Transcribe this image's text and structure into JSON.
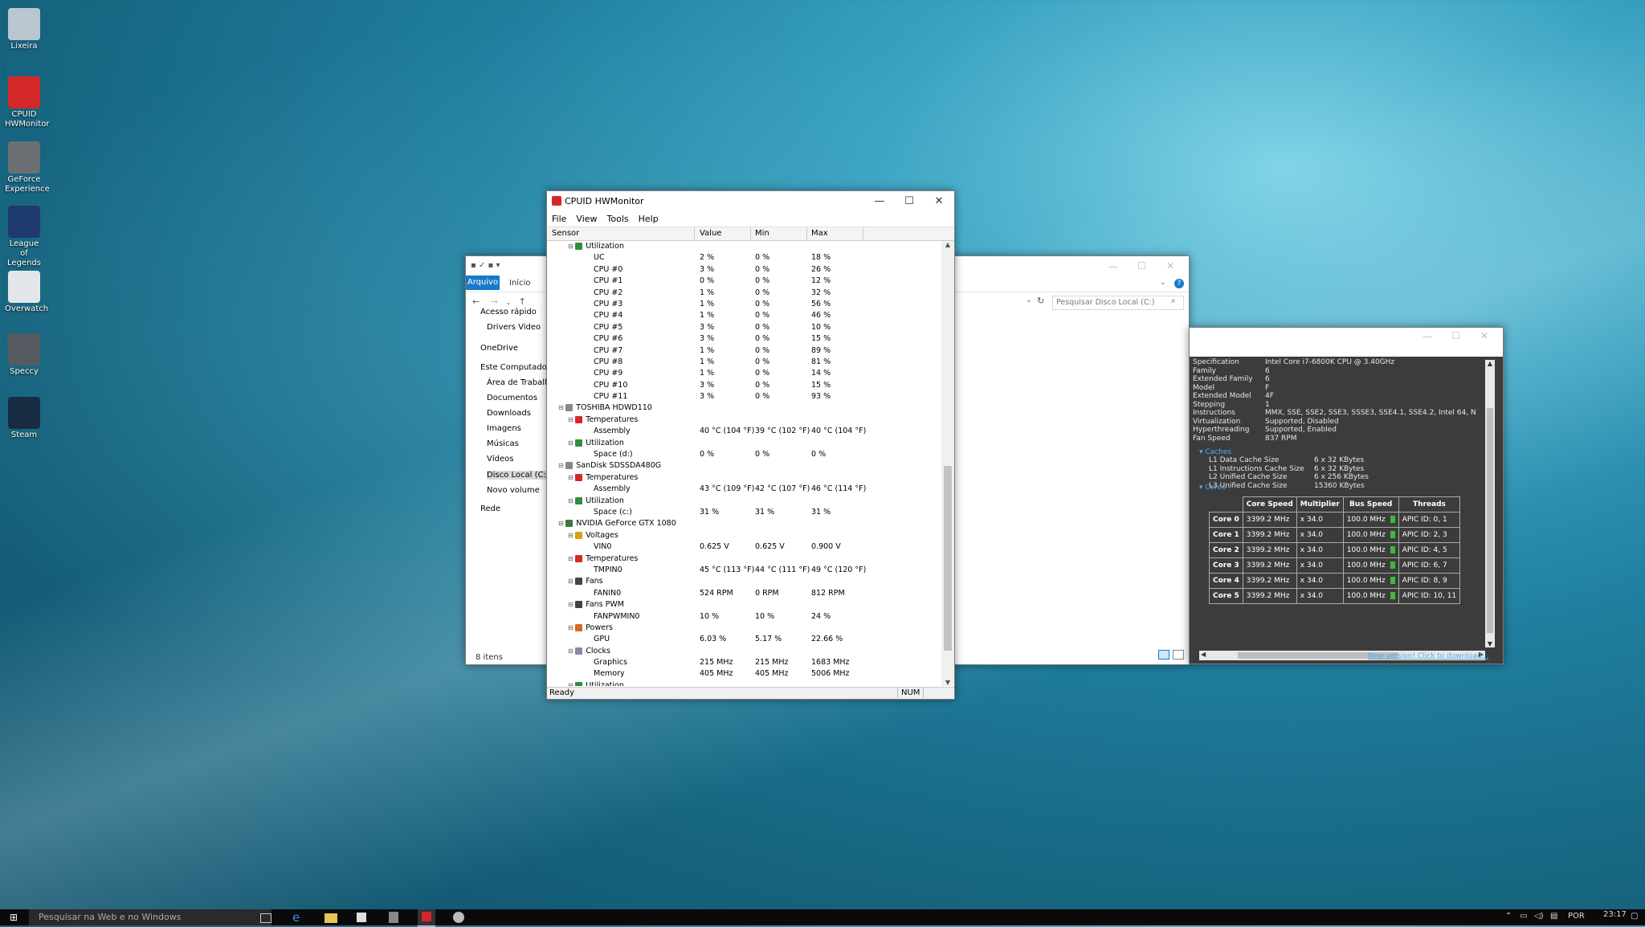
{
  "desktop": {
    "icons": [
      {
        "label": "Lixeira"
      },
      {
        "label": "CPUID HWMonitor"
      },
      {
        "label": "GeForce Experience"
      },
      {
        "label": "League of Legends"
      },
      {
        "label": "Overwatch"
      },
      {
        "label": "Speccy"
      },
      {
        "label": "Steam"
      }
    ]
  },
  "hwmonitor": {
    "title": "CPUID HWMonitor",
    "menu": [
      "File",
      "View",
      "Tools",
      "Help"
    ],
    "columns": {
      "sensor": "Sensor",
      "value": "Value",
      "min": "Min",
      "max": "Max"
    },
    "rows": [
      {
        "level": 2,
        "label": "Utilization",
        "value": "",
        "min": "",
        "max": "",
        "icon": "util"
      },
      {
        "level": 3,
        "label": "UC",
        "value": "2 %",
        "min": "0 %",
        "max": "18 %"
      },
      {
        "level": 3,
        "label": "CPU #0",
        "value": "3 %",
        "min": "0 %",
        "max": "26 %"
      },
      {
        "level": 3,
        "label": "CPU #1",
        "value": "0 %",
        "min": "0 %",
        "max": "12 %"
      },
      {
        "level": 3,
        "label": "CPU #2",
        "value": "1 %",
        "min": "0 %",
        "max": "32 %"
      },
      {
        "level": 3,
        "label": "CPU #3",
        "value": "1 %",
        "min": "0 %",
        "max": "56 %"
      },
      {
        "level": 3,
        "label": "CPU #4",
        "value": "1 %",
        "min": "0 %",
        "max": "46 %"
      },
      {
        "level": 3,
        "label": "CPU #5",
        "value": "3 %",
        "min": "0 %",
        "max": "10 %"
      },
      {
        "level": 3,
        "label": "CPU #6",
        "value": "3 %",
        "min": "0 %",
        "max": "15 %"
      },
      {
        "level": 3,
        "label": "CPU #7",
        "value": "1 %",
        "min": "0 %",
        "max": "89 %"
      },
      {
        "level": 3,
        "label": "CPU #8",
        "value": "1 %",
        "min": "0 %",
        "max": "81 %"
      },
      {
        "level": 3,
        "label": "CPU #9",
        "value": "1 %",
        "min": "0 %",
        "max": "14 %"
      },
      {
        "level": 3,
        "label": "CPU #10",
        "value": "3 %",
        "min": "0 %",
        "max": "15 %"
      },
      {
        "level": 3,
        "label": "CPU #11",
        "value": "3 %",
        "min": "0 %",
        "max": "93 %"
      },
      {
        "level": 1,
        "label": "TOSHIBA HDWD110",
        "value": "",
        "min": "",
        "max": "",
        "icon": "disk"
      },
      {
        "level": 2,
        "label": "Temperatures",
        "value": "",
        "min": "",
        "max": "",
        "icon": "temp"
      },
      {
        "level": 3,
        "label": "Assembly",
        "value": "40 °C (104 °F)",
        "min": "39 °C (102 °F)",
        "max": "40 °C (104 °F)"
      },
      {
        "level": 2,
        "label": "Utilization",
        "value": "",
        "min": "",
        "max": "",
        "icon": "util"
      },
      {
        "level": 3,
        "label": "Space (d:)",
        "value": "0 %",
        "min": "0 %",
        "max": "0 %"
      },
      {
        "level": 1,
        "label": "SanDisk SDSSDA480G",
        "value": "",
        "min": "",
        "max": "",
        "icon": "disk"
      },
      {
        "level": 2,
        "label": "Temperatures",
        "value": "",
        "min": "",
        "max": "",
        "icon": "temp"
      },
      {
        "level": 3,
        "label": "Assembly",
        "value": "43 °C (109 °F)",
        "min": "42 °C (107 °F)",
        "max": "46 °C (114 °F)"
      },
      {
        "level": 2,
        "label": "Utilization",
        "value": "",
        "min": "",
        "max": "",
        "icon": "util"
      },
      {
        "level": 3,
        "label": "Space (c:)",
        "value": "31 %",
        "min": "31 %",
        "max": "31 %"
      },
      {
        "level": 1,
        "label": "NVIDIA GeForce GTX 1080",
        "value": "",
        "min": "",
        "max": "",
        "icon": "gpu"
      },
      {
        "level": 2,
        "label": "Voltages",
        "value": "",
        "min": "",
        "max": "",
        "icon": "volt"
      },
      {
        "level": 3,
        "label": "VIN0",
        "value": "0.625 V",
        "min": "0.625 V",
        "max": "0.900 V"
      },
      {
        "level": 2,
        "label": "Temperatures",
        "value": "",
        "min": "",
        "max": "",
        "icon": "temp"
      },
      {
        "level": 3,
        "label": "TMPIN0",
        "value": "45 °C (113 °F)",
        "min": "44 °C (111 °F)",
        "max": "49 °C (120 °F)"
      },
      {
        "level": 2,
        "label": "Fans",
        "value": "",
        "min": "",
        "max": "",
        "icon": "fan"
      },
      {
        "level": 3,
        "label": "FANIN0",
        "value": "524 RPM",
        "min": "0 RPM",
        "max": "812 RPM"
      },
      {
        "level": 2,
        "label": "Fans PWM",
        "value": "",
        "min": "",
        "max": "",
        "icon": "fan"
      },
      {
        "level": 3,
        "label": "FANPWMIN0",
        "value": "10 %",
        "min": "10 %",
        "max": "24 %"
      },
      {
        "level": 2,
        "label": "Powers",
        "value": "",
        "min": "",
        "max": "",
        "icon": "power"
      },
      {
        "level": 3,
        "label": "GPU",
        "value": "6.03 %",
        "min": "5.17 %",
        "max": "22.66 %"
      },
      {
        "level": 2,
        "label": "Clocks",
        "value": "",
        "min": "",
        "max": "",
        "icon": "clock"
      },
      {
        "level": 3,
        "label": "Graphics",
        "value": "215 MHz",
        "min": "215 MHz",
        "max": "1683 MHz"
      },
      {
        "level": 3,
        "label": "Memory",
        "value": "405 MHz",
        "min": "405 MHz",
        "max": "5006 MHz"
      },
      {
        "level": 2,
        "label": "Utilization",
        "value": "",
        "min": "",
        "max": "",
        "icon": "util"
      }
    ],
    "status": "Ready",
    "status_num": "NUM"
  },
  "explorer": {
    "tab_active": "Arquivo",
    "tab_inicio": "Início",
    "search_placeholder": "Pesquisar Disco Local (C:)",
    "nav": [
      {
        "label": "Acesso rápido",
        "top": 0
      },
      {
        "label": "Drivers Video"
      },
      {
        "label": "OneDrive"
      },
      {
        "label": "Este Computador"
      },
      {
        "label": "Área de Trabalho"
      },
      {
        "label": "Documentos"
      },
      {
        "label": "Downloads"
      },
      {
        "label": "Imagens"
      },
      {
        "label": "Músicas"
      },
      {
        "label": "Vídeos"
      },
      {
        "label": "Disco Local (C:)"
      },
      {
        "label": "Novo volume"
      },
      {
        "label": "Rede"
      }
    ],
    "item_count": "8 itens"
  },
  "speccy": {
    "lines": [
      {
        "k": "Specification",
        "v": "Intel Core i7-6800K CPU @ 3.40GHz"
      },
      {
        "k": "Family",
        "v": "6"
      },
      {
        "k": "Extended Family",
        "v": "6"
      },
      {
        "k": "Model",
        "v": "F"
      },
      {
        "k": "Extended Model",
        "v": "4F"
      },
      {
        "k": "Stepping",
        "v": "1"
      },
      {
        "k": "Instructions",
        "v": "MMX, SSE, SSE2, SSE3, SSSE3, SSE4.1, SSE4.2, Intel 64, N"
      },
      {
        "k": "Virtualization",
        "v": "Supported, Disabled"
      },
      {
        "k": "Hyperthreading",
        "v": "Supported, Enabled"
      },
      {
        "k": "Fan Speed",
        "v": "837 RPM"
      }
    ],
    "caches_label": "Caches",
    "caches": [
      {
        "k": "L1 Data Cache Size",
        "v": "6 x 32 KBytes"
      },
      {
        "k": "L1 Instructions Cache Size",
        "v": "6 x 32 KBytes"
      },
      {
        "k": "L2 Unified Cache Size",
        "v": "6 x 256 KBytes"
      },
      {
        "k": "L3 Unified Cache Size",
        "v": "15360 KBytes"
      }
    ],
    "cores_label": "Cores",
    "table_headers": [
      "",
      "Core Speed",
      "Multiplier",
      "Bus Speed",
      "Threads"
    ],
    "cores": [
      {
        "name": "Core 0",
        "speed": "3399.2 MHz",
        "mult": "x 34.0",
        "bus": "100.0 MHz",
        "threads": "APIC ID: 0, 1"
      },
      {
        "name": "Core 1",
        "speed": "3399.2 MHz",
        "mult": "x 34.0",
        "bus": "100.0 MHz",
        "threads": "APIC ID: 2, 3"
      },
      {
        "name": "Core 2",
        "speed": "3399.2 MHz",
        "mult": "x 34.0",
        "bus": "100.0 MHz",
        "threads": "APIC ID: 4, 5"
      },
      {
        "name": "Core 3",
        "speed": "3399.2 MHz",
        "mult": "x 34.0",
        "bus": "100.0 MHz",
        "threads": "APIC ID: 6, 7"
      },
      {
        "name": "Core 4",
        "speed": "3399.2 MHz",
        "mult": "x 34.0",
        "bus": "100.0 MHz",
        "threads": "APIC ID: 8, 9"
      },
      {
        "name": "Core 5",
        "speed": "3399.2 MHz",
        "mult": "x 34.0",
        "bus": "100.0 MHz",
        "threads": "APIC ID: 10, 11"
      }
    ],
    "footer_link": "New version! Click to download..."
  },
  "taskbar": {
    "search_placeholder": "Pesquisar na Web e no Windows",
    "lang": "POR",
    "time": "23:17"
  },
  "colors": {
    "hwm_red": "#d42828",
    "explorer_blue": "#1979ca",
    "speccy_bg": "#3c3c3c",
    "link_blue": "#5aa9e6"
  }
}
